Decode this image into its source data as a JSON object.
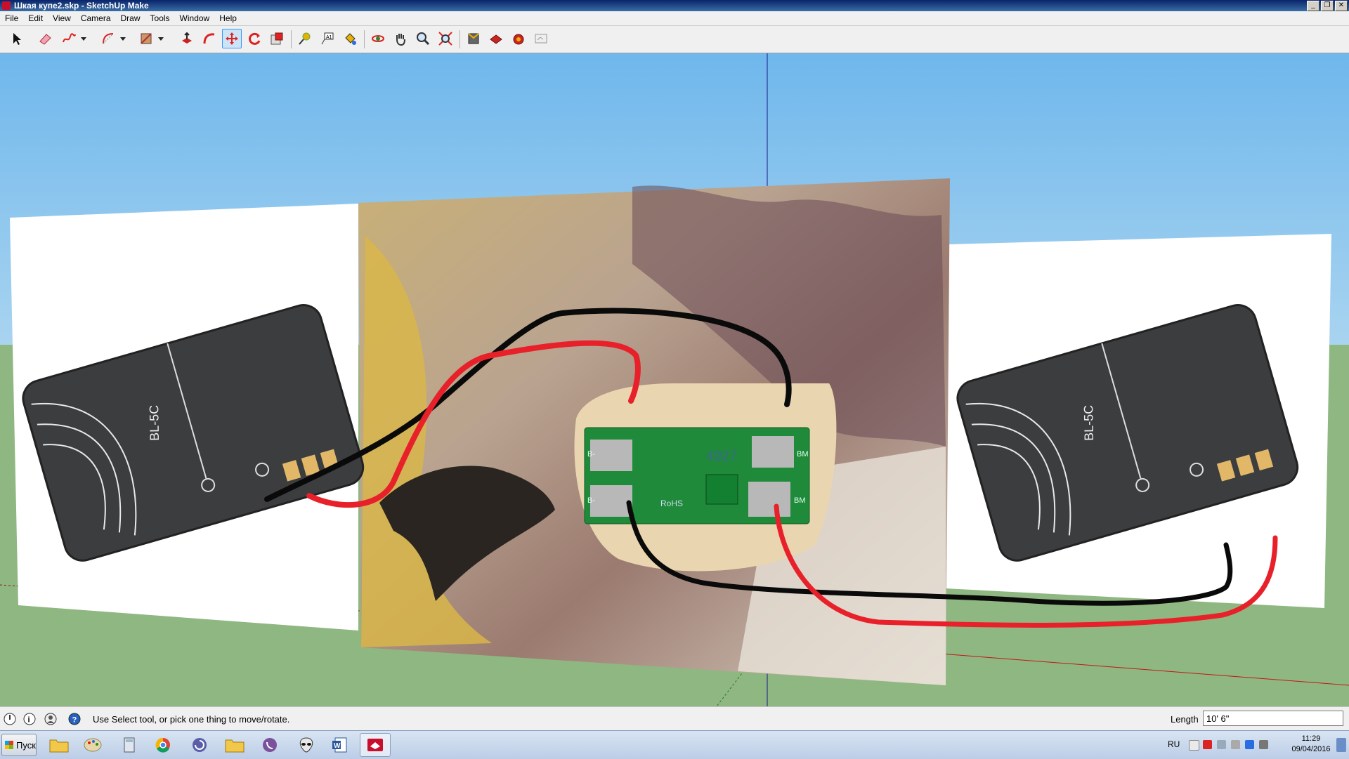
{
  "window": {
    "title": "Шкая купе2.skp - SketchUp Make",
    "minimize": "_",
    "restore": "❐",
    "close": "✕"
  },
  "menu": [
    "File",
    "Edit",
    "View",
    "Camera",
    "Draw",
    "Tools",
    "Window",
    "Help"
  ],
  "toolbar": {
    "tools": [
      {
        "name": "select-tool",
        "icon": "arrow-icon"
      },
      {
        "name": "eraser-tool",
        "icon": "eraser-icon"
      },
      {
        "name": "freehand-tool",
        "icon": "freehand-icon"
      },
      {
        "name": "freehand-dropdown",
        "icon": "chevron-down-icon"
      },
      {
        "name": "arc-tool",
        "icon": "arc-icon"
      },
      {
        "name": "arc-dropdown",
        "icon": "chevron-down-icon"
      },
      {
        "name": "rectangle-tool",
        "icon": "rectangle-icon"
      },
      {
        "name": "rectangle-dropdown",
        "icon": "chevron-down-icon"
      },
      {
        "name": "push-pull-tool",
        "icon": "push-pull-icon"
      },
      {
        "name": "follow-me-tool",
        "icon": "follow-me-icon"
      },
      {
        "name": "move-tool",
        "icon": "move-icon"
      },
      {
        "name": "rotate-tool",
        "icon": "rotate-icon"
      },
      {
        "name": "scale-tool",
        "icon": "scale-icon"
      },
      {
        "name": "tape-measure-tool",
        "icon": "tape-measure-icon"
      },
      {
        "name": "text-tool",
        "icon": "text-icon"
      },
      {
        "name": "paint-bucket-tool",
        "icon": "paint-bucket-icon"
      },
      {
        "name": "orbit-tool",
        "icon": "orbit-icon"
      },
      {
        "name": "pan-tool",
        "icon": "hand-icon"
      },
      {
        "name": "zoom-tool",
        "icon": "magnifier-icon"
      },
      {
        "name": "zoom-extents-tool",
        "icon": "zoom-extents-icon"
      },
      {
        "name": "3d-warehouse-button",
        "icon": "warehouse-icon"
      },
      {
        "name": "share-model-button",
        "icon": "share-icon"
      },
      {
        "name": "extension-warehouse-button",
        "icon": "extension-icon"
      },
      {
        "name": "layout-button",
        "icon": "layout-icon"
      }
    ],
    "active_tool": "move-tool"
  },
  "scene": {
    "left_battery_label": "BL-5C",
    "right_battery_label": "BL-5C",
    "board_label": "4927",
    "board_mark": "RoHS",
    "board_pad_left_top": "B-",
    "board_pad_left_bottom": "B-",
    "board_pad_right_top": "BM",
    "board_pad_right_bottom": "BM",
    "colors": {
      "sky": "#6fb7ec",
      "ground": "#8fb781",
      "wire_red": "#e8202a",
      "wire_black": "#0a0a0a",
      "pcb": "#1f8a3a",
      "battery": "#3b3d3f"
    }
  },
  "status": {
    "message": "Use Select tool, or pick one thing to move/rotate.",
    "measurement_label": "Length",
    "measurement_value": "10' 6\""
  },
  "taskbar": {
    "start_label": "Пуск",
    "apps": [
      "file-explorer",
      "paint",
      "calculator",
      "chrome",
      "fl-studio",
      "folder",
      "viber",
      "alien-app",
      "word",
      "sketchup"
    ],
    "active_app": "sketchup",
    "language": "RU",
    "time": "11:29",
    "date": "09/04/2016"
  }
}
